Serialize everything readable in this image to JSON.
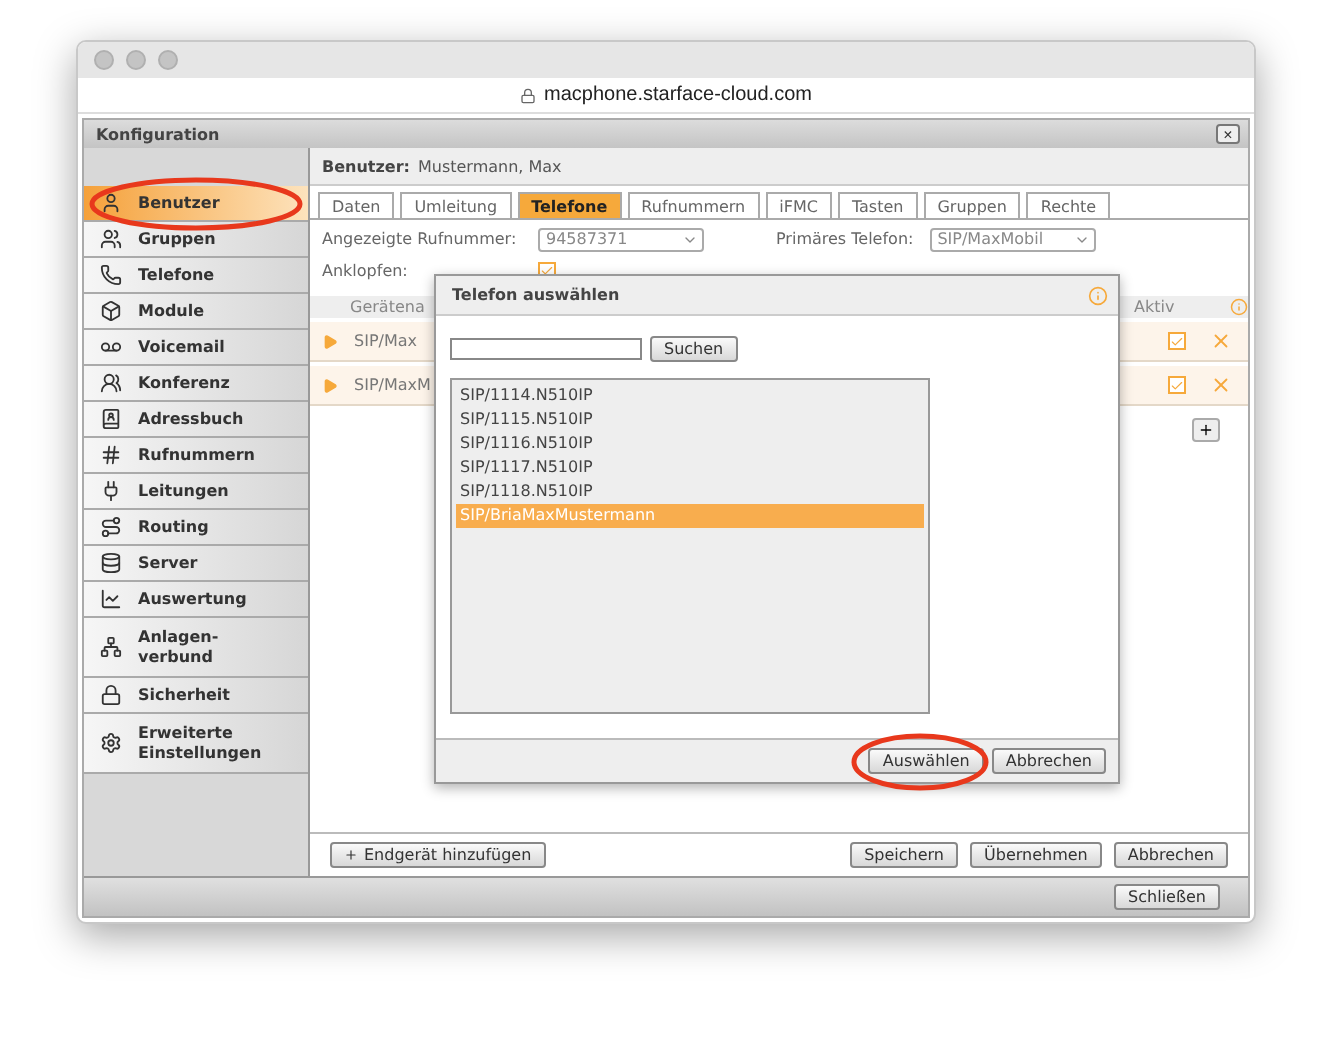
{
  "browser": {
    "url": "macphone.starface-cloud.com"
  },
  "panel": {
    "title": "Konfiguration",
    "close": "×"
  },
  "sidebar": {
    "items": [
      {
        "label": "Benutzer",
        "selected": true,
        "highlighted": true
      },
      {
        "label": "Gruppen",
        "selected": false,
        "highlighted": false
      },
      {
        "label": "Telefone",
        "selected": false,
        "highlighted": false
      },
      {
        "label": "Module",
        "selected": false,
        "highlighted": false
      },
      {
        "label": "Voicemail",
        "selected": false,
        "highlighted": false
      },
      {
        "label": "Konferenz",
        "selected": false,
        "highlighted": false
      },
      {
        "label": "Adressbuch",
        "selected": false,
        "highlighted": false
      },
      {
        "label": "Rufnummern",
        "selected": false,
        "highlighted": false
      },
      {
        "label": "Leitungen",
        "selected": false,
        "highlighted": false
      },
      {
        "label": "Routing",
        "selected": false,
        "highlighted": false
      },
      {
        "label": "Server",
        "selected": false,
        "highlighted": false
      },
      {
        "label": "Auswertung",
        "selected": false,
        "highlighted": false
      },
      {
        "label": "Anlagen-\nverbund",
        "selected": false,
        "highlighted": false
      },
      {
        "label": "Sicherheit",
        "selected": false,
        "highlighted": false
      },
      {
        "label": "Erweiterte\nEinstellungen",
        "selected": false,
        "highlighted": false
      }
    ]
  },
  "user": {
    "label": "Benutzer:",
    "name": "Mustermann, Max"
  },
  "tabs": [
    {
      "label": "Daten",
      "selected": false
    },
    {
      "label": "Umleitung",
      "selected": false
    },
    {
      "label": "Telefone",
      "selected": true
    },
    {
      "label": "Rufnummern",
      "selected": false
    },
    {
      "label": "iFMC",
      "selected": false
    },
    {
      "label": "Tasten",
      "selected": false
    },
    {
      "label": "Gruppen",
      "selected": false
    },
    {
      "label": "Rechte",
      "selected": false
    }
  ],
  "fields": {
    "displayed_number": {
      "label": "Angezeigte Rufnummer:",
      "value": "94587371"
    },
    "primary_phone": {
      "label": "Primäres Telefon:",
      "value": "SIP/MaxMobil"
    },
    "call_waiting": {
      "label": "Anklopfen:",
      "checked": true
    }
  },
  "table": {
    "columns": [
      "Gerätena",
      "Aktiv"
    ],
    "rows": [
      {
        "device": "SIP/Max",
        "active": true
      },
      {
        "device": "SIP/MaxM",
        "active": true
      }
    ]
  },
  "footer_buttons": {
    "add": "Endgerät hinzufügen",
    "save": "Speichern",
    "apply": "Übernehmen",
    "cancel": "Abbrechen",
    "close": "Schließen"
  },
  "dialog": {
    "title": "Telefon auswählen",
    "search_button": "Suchen",
    "items": [
      {
        "label": "SIP/1114.N510IP",
        "selected": false
      },
      {
        "label": "SIP/1115.N510IP",
        "selected": false
      },
      {
        "label": "SIP/1116.N510IP",
        "selected": false
      },
      {
        "label": "SIP/1117.N510IP",
        "selected": false
      },
      {
        "label": "SIP/1118.N510IP",
        "selected": false
      },
      {
        "label": "SIP/BriaMaxMustermann",
        "selected": true
      }
    ],
    "buttons": [
      {
        "label": "Auswählen",
        "highlighted": true
      },
      {
        "label": "Abbrechen",
        "highlighted": false
      }
    ]
  }
}
